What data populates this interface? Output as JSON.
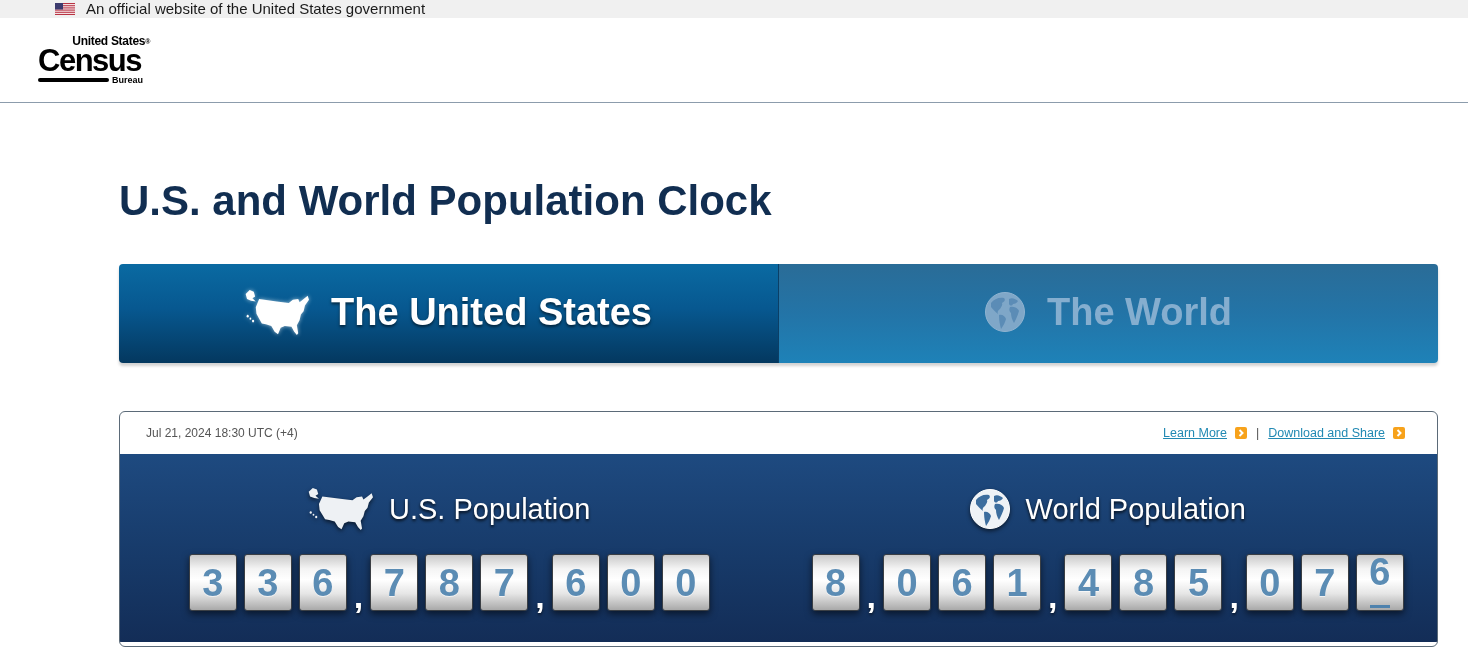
{
  "gov_banner": {
    "text": "An official website of the United States government"
  },
  "logo": {
    "top": "United States$^{®}$",
    "wordmark": "Census",
    "bottom": "Bureau"
  },
  "page_title": "U.S. and World Population Clock",
  "tabs": [
    {
      "kind": "us",
      "label": "The United States",
      "selected": true
    },
    {
      "kind": "world",
      "label": "The World",
      "selected": false
    }
  ],
  "clock": {
    "timestamp": "Jul 21, 2024 18:30 UTC (+4)",
    "links": [
      {
        "label": "Learn More"
      },
      {
        "label": "Download and Share"
      }
    ],
    "separator": "|",
    "counters": [
      {
        "kind": "us",
        "title": "U.S. Population",
        "digits": [
          {
            "kind": "digit",
            "text": "3",
            "rolling": false
          },
          {
            "kind": "digit",
            "text": "3",
            "rolling": false
          },
          {
            "kind": "digit",
            "text": "6",
            "rolling": false
          },
          {
            "kind": "comma",
            "text": ","
          },
          {
            "kind": "digit",
            "text": "7",
            "rolling": false
          },
          {
            "kind": "digit",
            "text": "8",
            "rolling": false
          },
          {
            "kind": "digit",
            "text": "7",
            "rolling": false
          },
          {
            "kind": "comma",
            "text": ","
          },
          {
            "kind": "digit",
            "text": "6",
            "rolling": false
          },
          {
            "kind": "digit",
            "text": "0",
            "rolling": false
          },
          {
            "kind": "digit",
            "text": "0",
            "rolling": false
          }
        ]
      },
      {
        "kind": "world",
        "title": "World Population",
        "digits": [
          {
            "kind": "digit",
            "text": "8",
            "rolling": false
          },
          {
            "kind": "comma",
            "text": ","
          },
          {
            "kind": "digit",
            "text": "0",
            "rolling": false
          },
          {
            "kind": "digit",
            "text": "6",
            "rolling": false
          },
          {
            "kind": "digit",
            "text": "1",
            "rolling": false
          },
          {
            "kind": "comma",
            "text": ","
          },
          {
            "kind": "digit",
            "text": "4",
            "rolling": false
          },
          {
            "kind": "digit",
            "text": "8",
            "rolling": false
          },
          {
            "kind": "digit",
            "text": "5",
            "rolling": false
          },
          {
            "kind": "comma",
            "text": ","
          },
          {
            "kind": "digit",
            "text": "0",
            "rolling": false
          },
          {
            "kind": "digit",
            "text": "7",
            "rolling": false
          },
          {
            "kind": "digit",
            "text": "6",
            "rolling": true
          }
        ]
      }
    ]
  }
}
